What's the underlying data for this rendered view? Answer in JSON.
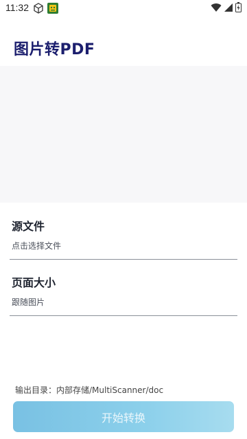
{
  "status_bar": {
    "time": "11:32",
    "icons_left": [
      "cube-icon",
      "app-notification-icon"
    ],
    "icons_right": [
      "wifi-icon",
      "signal-icon",
      "battery-icon"
    ]
  },
  "header": {
    "title": "图片转PDF"
  },
  "source_file": {
    "label": "源文件",
    "placeholder": "点击选择文件"
  },
  "page_size": {
    "label": "页面大小",
    "value": "跟随图片"
  },
  "output": {
    "directory_text": "输出目录：内部存储/MultiScanner/doc"
  },
  "actions": {
    "start_label": "开始转换"
  },
  "colors": {
    "title": "#1c1f6e",
    "button_start": "#79c1e3",
    "button_end": "#a7dcef",
    "preview_bg": "#f7f7f9"
  }
}
